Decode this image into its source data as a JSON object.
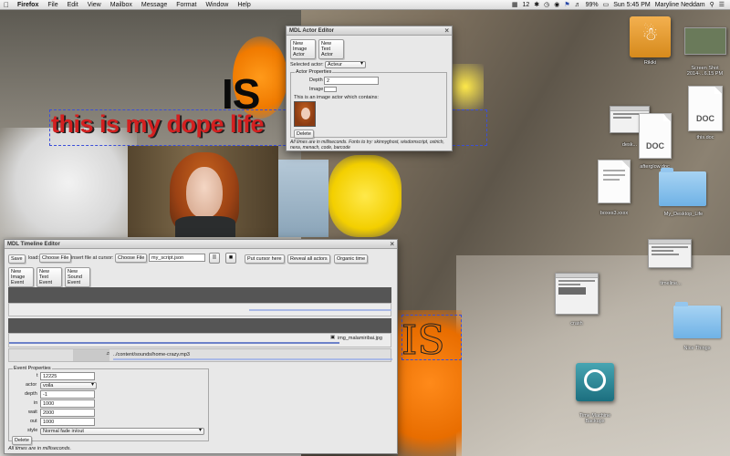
{
  "menubar": {
    "app": "Firefox",
    "items": [
      "File",
      "Edit",
      "View",
      "Mailbox",
      "Message",
      "Format",
      "Window",
      "Help"
    ],
    "status_badge": "12",
    "battery": "99%",
    "clock": "Sun 5:45 PM",
    "user": "Maryline Neddam"
  },
  "overlays": {
    "big_is": "IS",
    "flipped_line": "this is my dope life",
    "outline_is": "IS"
  },
  "actor_editor": {
    "title": "MDL Actor Editor",
    "new_image_actor": "New Image Actor",
    "new_text_actor": "New Text Actor",
    "selected_actor_label": "Selected actor:",
    "selected_actor_value": "Acteur",
    "props_legend": "Actor Properties",
    "depth_label": "Depth",
    "depth_value": "2",
    "image_label": "Image",
    "image_actor_note": "This is an image actor which contains:",
    "delete": "Delete",
    "footnote": "All times are in milliseconds. Fonts to try: skinnyghost, wisdomscript, ostrich, nexa, menach, code, barcode"
  },
  "timeline_editor": {
    "title": "MDL Timeline Editor",
    "save": "Save",
    "load_label": "load:",
    "choose_file_1": "Choose File",
    "insert_label": "insert file at cursor:",
    "choose_file_2": "Choose File",
    "script_field": "my_script.json",
    "pause_icon": "II",
    "stop_icon": "■",
    "put_cursor": "Put cursor here",
    "reveal_actors": "Reveal all actors",
    "organic_time": "Organic time",
    "new_image_event": "New Image Event",
    "new_text_event": "New Text Event",
    "new_sound_event": "New Sound Event",
    "image_event_label": "img_malamiribai.jpg",
    "sound_event_label": "../content/sounds/home-crazy.mp3",
    "event_props_legend": "Event Properties",
    "fields": [
      {
        "label": "t",
        "value": "12225"
      },
      {
        "label": "actor",
        "value": "voila"
      },
      {
        "label": "depth",
        "value": "-1"
      },
      {
        "label": "in",
        "value": "1000"
      },
      {
        "label": "wait",
        "value": "2000"
      },
      {
        "label": "out",
        "value": "1000"
      },
      {
        "label": "style",
        "value": "Normal fade in/out"
      }
    ],
    "delete": "Delete",
    "footnote": "All times are in milliseconds."
  },
  "desktop_icons": {
    "usb": "Rikiki",
    "screenshot": "Screen Shot 2014-...6.15 PM",
    "doc1": "DOC",
    "doc1_label": "desk...",
    "doc2": "DOC",
    "doc2_label": "afterglow.doc",
    "doc3_label": "this.doc",
    "doc4_label": "boxes3.xxxx",
    "folder1": "My_Desktop_Life",
    "timeline_label": "timeline...",
    "crash_label": "crash",
    "folder2": "Nice Things",
    "time_machine": "Time Machine Backups"
  }
}
